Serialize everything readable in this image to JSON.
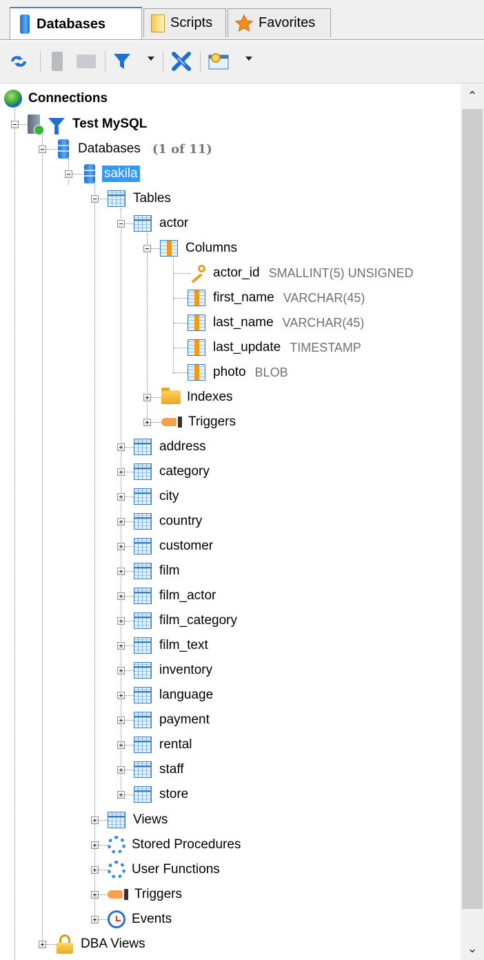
{
  "tabs": [
    {
      "label": "Databases",
      "icon": "database-icon",
      "active": true
    },
    {
      "label": "Scripts",
      "icon": "script-icon",
      "active": false
    },
    {
      "label": "Favorites",
      "icon": "star-icon",
      "active": false
    }
  ],
  "toolbar": {
    "buttons": [
      "refresh-icon",
      "new-connection-icon",
      "new-folder-icon",
      "filter-icon",
      "filter-dropdown-icon",
      "disconnect-icon",
      "options-icon",
      "options-dropdown-icon"
    ]
  },
  "tree": {
    "root": "Connections",
    "connection": "Test MySQL",
    "databases_label": "Databases",
    "databases_count": "(1 of 11)",
    "database": "sakila",
    "tables_label": "Tables",
    "actor": "actor",
    "columns_label": "Columns",
    "columns": [
      {
        "name": "actor_id",
        "type": "SMALLINT(5) UNSIGNED",
        "key": true
      },
      {
        "name": "first_name",
        "type": "VARCHAR(45)",
        "key": false
      },
      {
        "name": "last_name",
        "type": "VARCHAR(45)",
        "key": false
      },
      {
        "name": "last_update",
        "type": "TIMESTAMP",
        "key": false
      },
      {
        "name": "photo",
        "type": "BLOB",
        "key": false
      }
    ],
    "indexes_label": "Indexes",
    "table_triggers_label": "Triggers",
    "tables": [
      "address",
      "category",
      "city",
      "country",
      "customer",
      "film",
      "film_actor",
      "film_category",
      "film_text",
      "inventory",
      "language",
      "payment",
      "rental",
      "staff",
      "store"
    ],
    "views_label": "Views",
    "stored_procedures_label": "Stored Procedures",
    "user_functions_label": "User Functions",
    "triggers_label": "Triggers",
    "events_label": "Events",
    "dba_views_label": "DBA Views"
  },
  "colors": {
    "selection": "#3399ff",
    "accent": "#1e6fd0"
  }
}
